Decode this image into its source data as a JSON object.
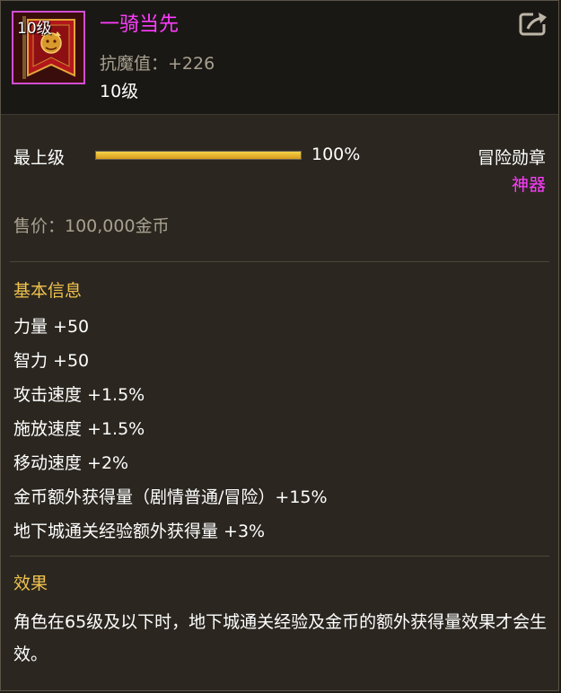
{
  "colors": {
    "rarity_accent": "#ff3cff",
    "section_title": "#f0c24e",
    "muted_text": "#a8a090",
    "bar_fill": "#e0a82a"
  },
  "header": {
    "icon_name": "banner-icon",
    "icon_level": "10级",
    "item_name": "一骑当先",
    "stat_line": "抗魔值：+226",
    "level": "10级",
    "export_icon": "share-export-icon"
  },
  "progress": {
    "label": "最上级",
    "fraction": 1.0,
    "text": "100%"
  },
  "category": {
    "type": "冒险勋章",
    "rarity": "神器"
  },
  "price": "售价：100,000金币",
  "basic_info": {
    "title": "基本信息",
    "stats": [
      "力量 +50",
      "智力 +50",
      "攻击速度 +1.5%",
      "施放速度 +1.5%",
      "移动速度 +2%",
      "金币额外获得量（剧情普通/冒险）+15%",
      "地下城通关经验额外获得量 +3%"
    ]
  },
  "effect": {
    "title": "效果",
    "text": "角色在65级及以下时，地下城通关经验及金币的额外获得量效果才会生效。"
  }
}
